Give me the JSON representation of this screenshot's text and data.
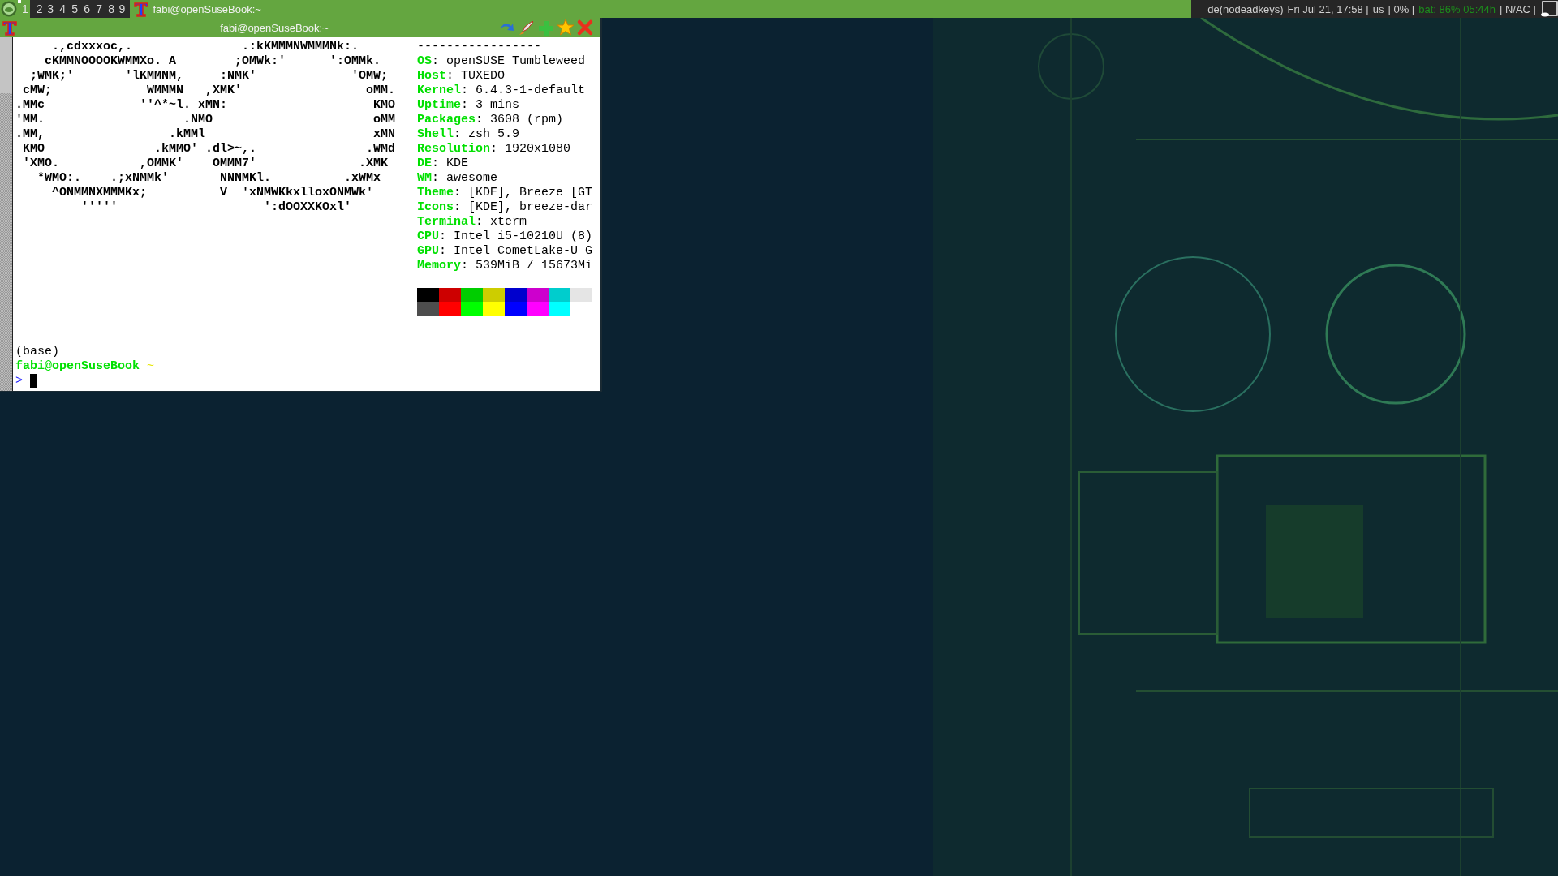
{
  "top_bar": {
    "tags": [
      {
        "label": "1",
        "selected": true,
        "occupied": true
      },
      {
        "label": "2",
        "selected": false,
        "occupied": false
      },
      {
        "label": "3",
        "selected": false,
        "occupied": false
      },
      {
        "label": "4",
        "selected": false,
        "occupied": false
      },
      {
        "label": "5",
        "selected": false,
        "occupied": false
      },
      {
        "label": "6",
        "selected": false,
        "occupied": false
      },
      {
        "label": "7",
        "selected": false,
        "occupied": false
      },
      {
        "label": "8",
        "selected": false,
        "occupied": false
      },
      {
        "label": "9",
        "selected": false,
        "occupied": false
      }
    ],
    "task": {
      "title": "fabi@openSuseBook:~"
    },
    "status": [
      {
        "kind": "plain",
        "text": "de(nodeadkeys)"
      },
      {
        "kind": "plain",
        "text": "Fri Jul 21, 17:58 |"
      },
      {
        "kind": "plain",
        "text": "us"
      },
      {
        "kind": "plain",
        "text": "| 0% |"
      },
      {
        "kind": "battery",
        "text": "bat: 86% 05:44h"
      },
      {
        "kind": "plain",
        "text": "| N/AC |"
      }
    ]
  },
  "terminal": {
    "title": "fabi@openSuseBook:~",
    "ascii_art": [
      "     .,cdxxxoc,.               .:kKMMMNWMMMNk:.",
      "    cKMMNOOOOKWMMXo. A        ;OMWk:'      ':OMMk.",
      "  ;WMK;'       'lKMMNM,     :NMK'             'OMW;",
      " cMW;             WMMMN   ,XMK'                 oMM.",
      ".MMc             ''^*~l. xMN:                    KMO",
      "'MM.                   .NMO                      oMM",
      ".MM,                 .kMMl                       xMN",
      " KMO               .kMMO' .dl>~,.               .WMd",
      " 'XMO.           ,OMMK'    OMMM7'              .XMK",
      "   *WMO:.    .;xNMMk'       NNNMKl.          .xWMx",
      "     ^ONMMNXMMMKx;          V  'xNMWKkxlloxONMWk'",
      "         '''''                    ':dOOXXKOxl'"
    ],
    "separator": "-----------------",
    "info": [
      {
        "label": "OS",
        "value": ": openSUSE Tumbleweed"
      },
      {
        "label": "Host",
        "value": ": TUXEDO"
      },
      {
        "label": "Kernel",
        "value": ": 6.4.3-1-default"
      },
      {
        "label": "Uptime",
        "value": ": 3 mins"
      },
      {
        "label": "Packages",
        "value": ": 3608 (rpm)"
      },
      {
        "label": "Shell",
        "value": ": zsh 5.9"
      },
      {
        "label": "Resolution",
        "value": ": 1920x1080"
      },
      {
        "label": "DE",
        "value": ": KDE"
      },
      {
        "label": "WM",
        "value": ": awesome"
      },
      {
        "label": "Theme",
        "value": ": [KDE], Breeze [GT"
      },
      {
        "label": "Icons",
        "value": ": [KDE], breeze-dar"
      },
      {
        "label": "Terminal",
        "value": ": xterm"
      },
      {
        "label": "CPU",
        "value": ": Intel i5-10210U (8)"
      },
      {
        "label": "GPU",
        "value": ": Intel CometLake-U G"
      },
      {
        "label": "Memory",
        "value": ": 539MiB / 15673Mi"
      }
    ],
    "palette": [
      [
        {
          "color": "#000000"
        },
        {
          "color": "#cd0000"
        },
        {
          "color": "#00cd00"
        },
        {
          "color": "#cdcd00"
        },
        {
          "color": "#0000cd"
        },
        {
          "color": "#cd00cd"
        },
        {
          "color": "#00cdcd"
        },
        {
          "color": "#e5e5e5"
        }
      ],
      [
        {
          "color": "#4d4d4d"
        },
        {
          "color": "#ff0000"
        },
        {
          "color": "#00ff00"
        },
        {
          "color": "#ffff00"
        },
        {
          "color": "#0000ff"
        },
        {
          "color": "#ff00ff"
        },
        {
          "color": "#00ffff"
        }
      ]
    ],
    "lines": [
      {
        "kind": "plain",
        "text": "(base)"
      },
      {
        "kind": "prompt",
        "user": "fabi@openSuseBook",
        "dir": "~"
      },
      {
        "kind": "input",
        "symbol": ">"
      }
    ]
  }
}
